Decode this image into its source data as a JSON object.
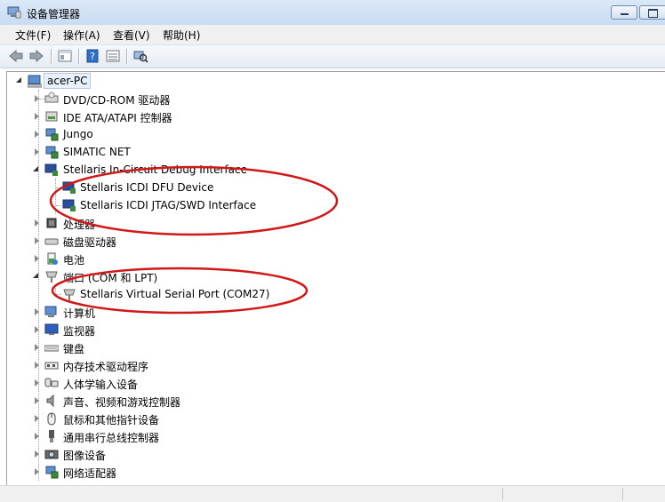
{
  "window": {
    "title": "设备管理器"
  },
  "menu": [
    "文件(F)",
    "操作(A)",
    "查看(V)",
    "帮助(H)"
  ],
  "toolbar_icons": [
    "back-arrow-icon",
    "forward-arrow-icon",
    "properties-icon",
    "help-icon",
    "view-icon",
    "scan-hardware-icon"
  ],
  "tree": {
    "root": "acer-PC",
    "items": [
      {
        "label": "DVD/CD-ROM 驱动器",
        "icon": "dvd-drive-icon",
        "expanded": false
      },
      {
        "label": "IDE ATA/ATAPI 控制器",
        "icon": "ide-controller-icon",
        "expanded": false
      },
      {
        "label": "Jungo",
        "icon": "device-icon",
        "expanded": false
      },
      {
        "label": "SIMATIC NET",
        "icon": "network-device-icon",
        "expanded": false
      },
      {
        "label": "Stellaris In-Circuit Debug Interface",
        "icon": "debug-interface-icon",
        "expanded": true,
        "children": [
          {
            "label": "Stellaris ICDI DFU Device",
            "icon": "debug-device-icon"
          },
          {
            "label": "Stellaris ICDI JTAG/SWD Interface",
            "icon": "debug-device-icon"
          }
        ]
      },
      {
        "label": "处理器",
        "icon": "processor-icon",
        "expanded": false
      },
      {
        "label": "磁盘驱动器",
        "icon": "disk-drive-icon",
        "expanded": false
      },
      {
        "label": "电池",
        "icon": "battery-icon",
        "expanded": false
      },
      {
        "label": "端口 (COM 和 LPT)",
        "icon": "port-icon",
        "expanded": true,
        "children": [
          {
            "label": "Stellaris Virtual Serial Port (COM27)",
            "icon": "port-icon"
          }
        ]
      },
      {
        "label": "计算机",
        "icon": "computer-icon",
        "expanded": false
      },
      {
        "label": "监视器",
        "icon": "monitor-icon",
        "expanded": false
      },
      {
        "label": "键盘",
        "icon": "keyboard-icon",
        "expanded": false
      },
      {
        "label": "内存技术驱动程序",
        "icon": "memory-icon",
        "expanded": false
      },
      {
        "label": "人体学输入设备",
        "icon": "hid-icon",
        "expanded": false
      },
      {
        "label": "声音、视频和游戏控制器",
        "icon": "sound-icon",
        "expanded": false
      },
      {
        "label": "鼠标和其他指针设备",
        "icon": "mouse-icon",
        "expanded": false
      },
      {
        "label": "通用串行总线控制器",
        "icon": "usb-icon",
        "expanded": false
      },
      {
        "label": "图像设备",
        "icon": "imaging-icon",
        "expanded": false
      },
      {
        "label": "网络适配器",
        "icon": "network-adapter-icon",
        "expanded": false
      }
    ]
  },
  "annotation_color": "#d01818"
}
